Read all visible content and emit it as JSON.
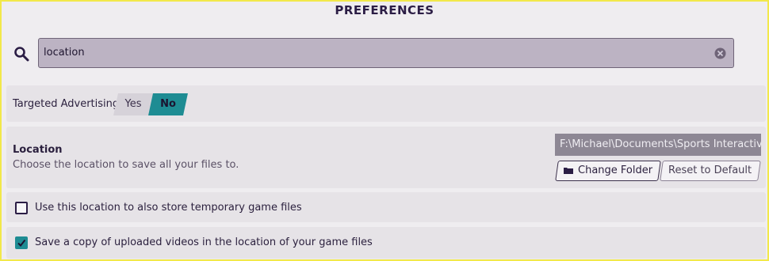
{
  "header": {
    "title": "PREFERENCES"
  },
  "search": {
    "value": "location",
    "icon": "search-icon",
    "clear_icon": "clear-icon"
  },
  "targeted_advertising": {
    "label": "Targeted Advertising",
    "options": [
      "Yes",
      "No"
    ],
    "selected": "No"
  },
  "location": {
    "title": "Location",
    "description": "Choose the location to save all your files to.",
    "path": "F:\\Michael\\Documents\\Sports Interactiv...",
    "change_folder_label": "Change Folder",
    "reset_label": "Reset to Default"
  },
  "options": [
    {
      "label": "Use this location to also store temporary game files",
      "checked": false
    },
    {
      "label": "Save a copy of uploaded videos in the location of your game files",
      "checked": true
    }
  ],
  "colors": {
    "accent": "#1e8c93",
    "frame": "#f2e84a",
    "search_bg": "#bcb3c3"
  }
}
